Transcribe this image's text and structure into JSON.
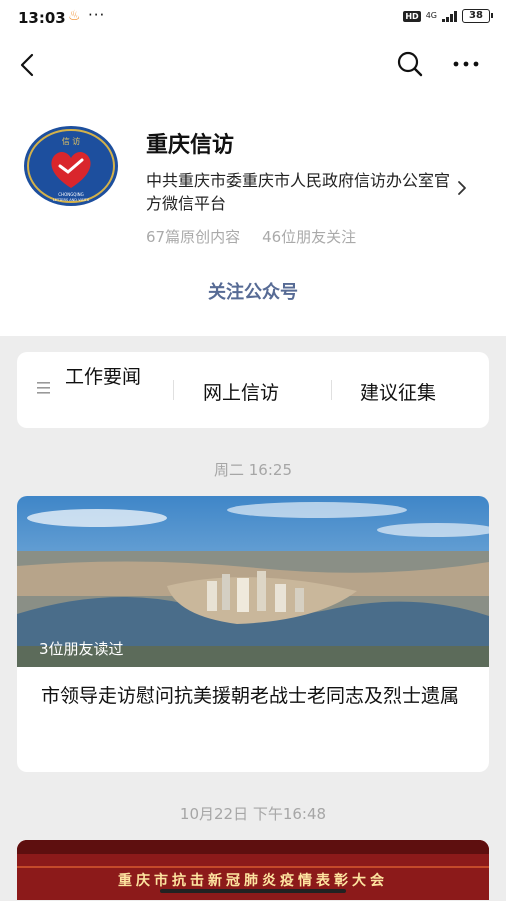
{
  "status_bar": {
    "time": "13:03",
    "dots": "···",
    "network": "4G",
    "battery": "38"
  },
  "account": {
    "name": "重庆信访",
    "description": "中共重庆市委重庆市人民政府信访办公室官方微信平台",
    "original_count": "67篇原创内容",
    "friends_following": "46位朋友关注"
  },
  "follow_button": "关注公众号",
  "menu": {
    "items": [
      {
        "label": "工作要闻"
      },
      {
        "label": "网上信访"
      },
      {
        "label": "建议征集"
      }
    ]
  },
  "articles": [
    {
      "timestamp": "周二 16:25",
      "read_badge": "3位朋友读过",
      "title": "市领导走访慰问抗美援朝老战士老同志及烈士遗属"
    },
    {
      "timestamp": "10月22日 下午16:48",
      "banner_text": "重庆市抗击新冠肺炎疫情表彰大会"
    }
  ],
  "colors": {
    "link_blue": "#576b95",
    "logo_blue": "#1d4f9e",
    "logo_red": "#d9262c",
    "banner_red": "#8c1a1a"
  }
}
